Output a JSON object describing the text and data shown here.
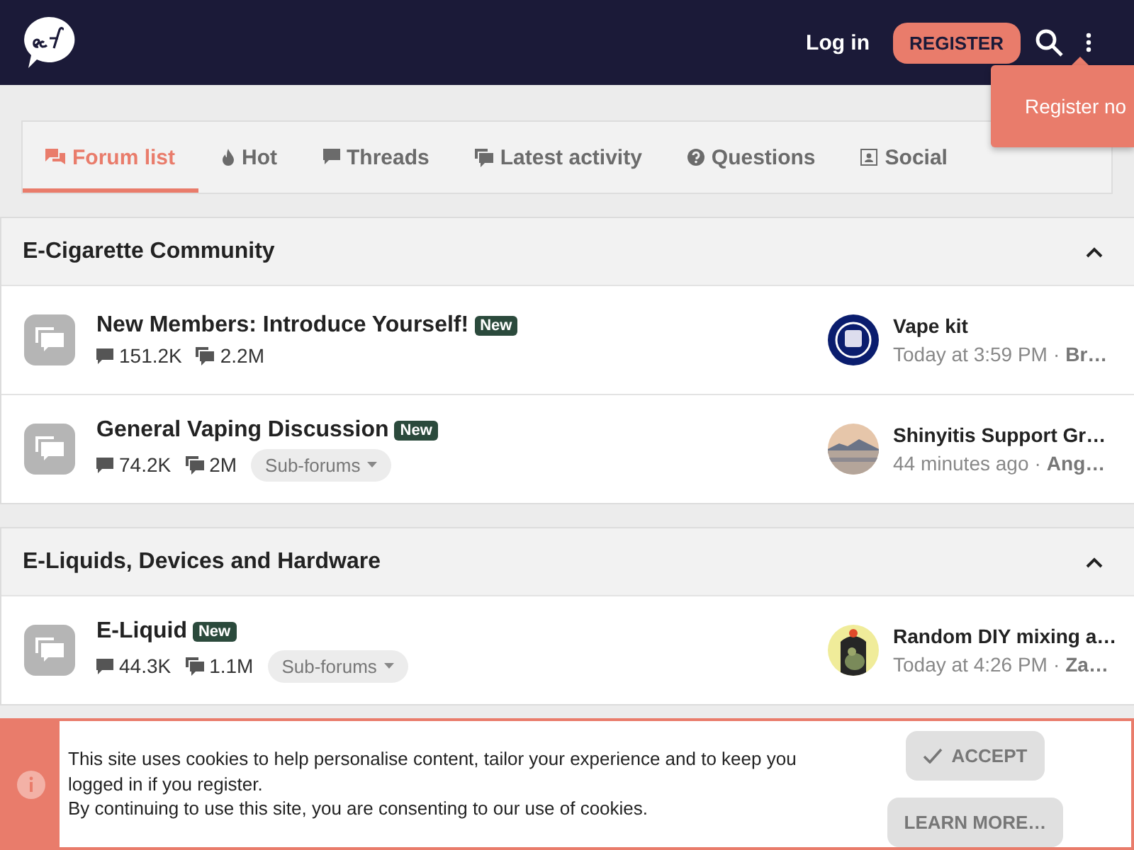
{
  "header": {
    "login": "Log in",
    "register": "REGISTER",
    "tooltip": "Register no"
  },
  "tabs": [
    {
      "label": "Forum list",
      "selected": true
    },
    {
      "label": "Hot",
      "selected": false
    },
    {
      "label": "Threads",
      "selected": false
    },
    {
      "label": "Latest activity",
      "selected": false
    },
    {
      "label": "Questions",
      "selected": false
    },
    {
      "label": "Social",
      "selected": false
    }
  ],
  "categories": [
    {
      "title": "E-Cigarette Community",
      "expanded": true,
      "forums": [
        {
          "title": "New Members: Introduce Yourself!",
          "badge": "New",
          "threads": "151.2K",
          "messages": "2.2M",
          "last_title": "Vape kit",
          "last_time": "Today at 3:59 PM",
          "separator": "·",
          "last_user": "Br…"
        },
        {
          "title": "General Vaping Discussion",
          "badge": "New",
          "threads": "74.2K",
          "messages": "2M",
          "subforums": "Sub-forums",
          "last_title": "Shinyitis Support Gr…",
          "last_time": "44 minutes ago",
          "separator": "·",
          "last_user": "Ang…"
        }
      ]
    },
    {
      "title": "E-Liquids, Devices and Hardware",
      "expanded": true,
      "forums": [
        {
          "title": "E-Liquid",
          "badge": "New",
          "threads": "44.3K",
          "messages": "1.1M",
          "subforums": "Sub-forums",
          "last_title": "Random DIY mixing a…",
          "last_time": "Today at 4:26 PM",
          "separator": "·",
          "last_user": "Za…"
        }
      ]
    }
  ],
  "cookie": {
    "lines": [
      "This site uses cookies to help personalise content, tailor your experience and to keep you logged in if you register.",
      "By continuing to use this site, you are consenting to our use of cookies."
    ],
    "accept": "ACCEPT",
    "learn": "LEARN MORE…"
  }
}
